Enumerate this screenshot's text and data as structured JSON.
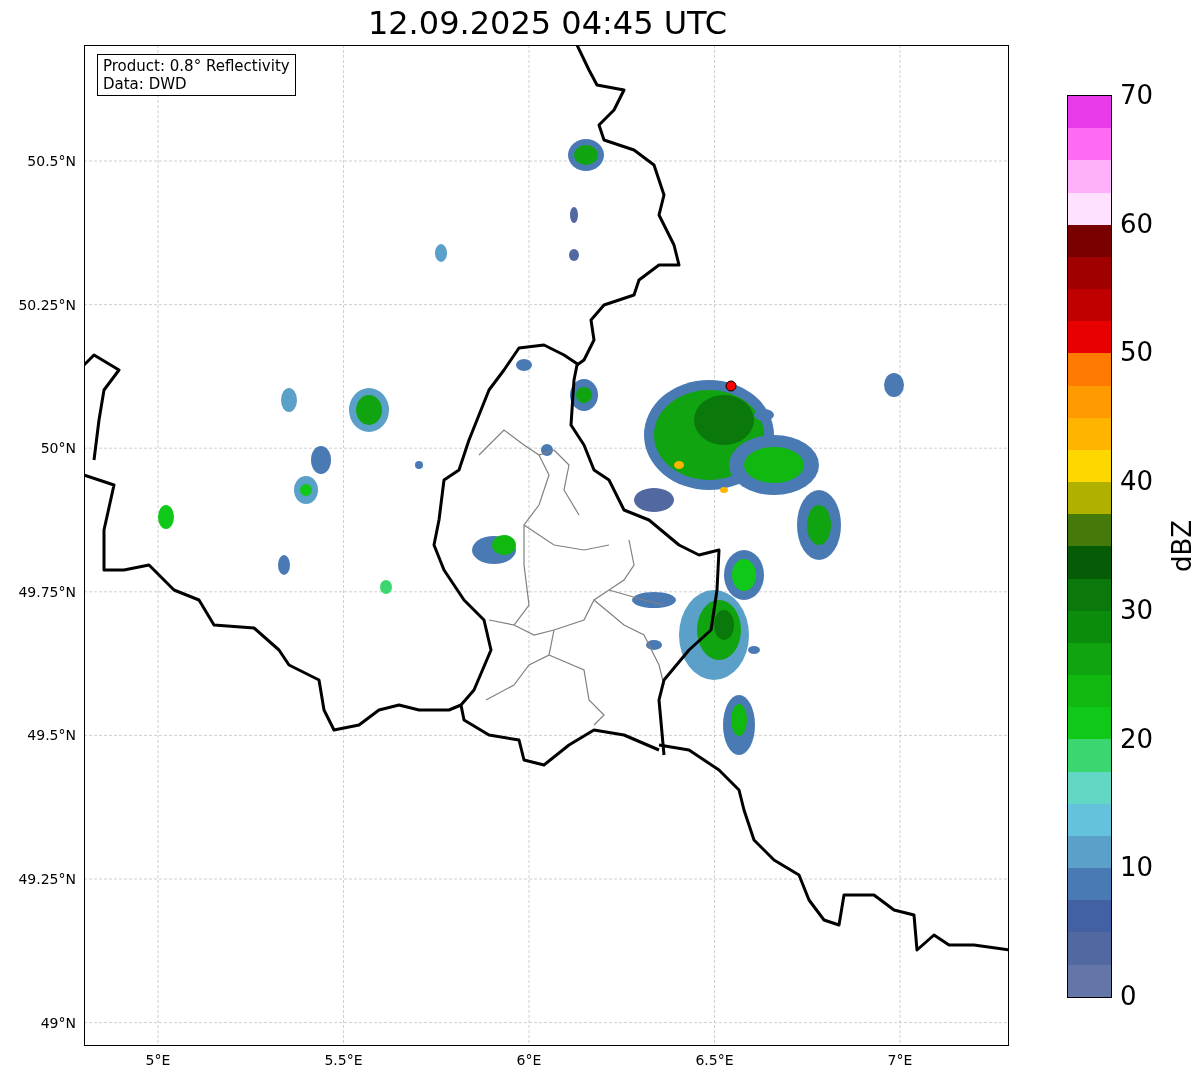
{
  "title": "12.09.2025 04:45 UTC",
  "map": {
    "info_box": [
      "Product: 0.8° Reflectivity",
      "Data: DWD"
    ],
    "lat_ticks": [
      "50.5°N",
      "50.25°N",
      "50°N",
      "49.75°N",
      "49.5°N",
      "49.25°N",
      "49°N"
    ],
    "lon_ticks": [
      "5°E",
      "5.5°E",
      "6°E",
      "6.5°E",
      "7°E"
    ]
  },
  "colorbar": {
    "label": "dBZ",
    "ticks": [
      "70",
      "60",
      "50",
      "40",
      "30",
      "20",
      "10",
      "0"
    ],
    "segments": [
      {
        "color": "#6476a8"
      },
      {
        "color": "#5268a0"
      },
      {
        "color": "#4360a2"
      },
      {
        "color": "#4a7ab4"
      },
      {
        "color": "#5aa0c8"
      },
      {
        "color": "#64c2dc"
      },
      {
        "color": "#62d8c4"
      },
      {
        "color": "#3cd670"
      },
      {
        "color": "#10c818"
      },
      {
        "color": "#10b810"
      },
      {
        "color": "#10a410"
      },
      {
        "color": "#0c8c0c"
      },
      {
        "color": "#0a780a"
      },
      {
        "color": "#065c06"
      },
      {
        "color": "#457a0a"
      },
      {
        "color": "#afb000"
      },
      {
        "color": "#ffd700"
      },
      {
        "color": "#ffb400"
      },
      {
        "color": "#ff9a00"
      },
      {
        "color": "#ff7a00"
      },
      {
        "color": "#e60000"
      },
      {
        "color": "#c00000"
      },
      {
        "color": "#a00000"
      },
      {
        "color": "#780000"
      },
      {
        "color": "#ffe0ff"
      },
      {
        "color": "#ffb0fb"
      },
      {
        "color": "#ff6af5"
      },
      {
        "color": "#e93ae9"
      }
    ]
  }
}
